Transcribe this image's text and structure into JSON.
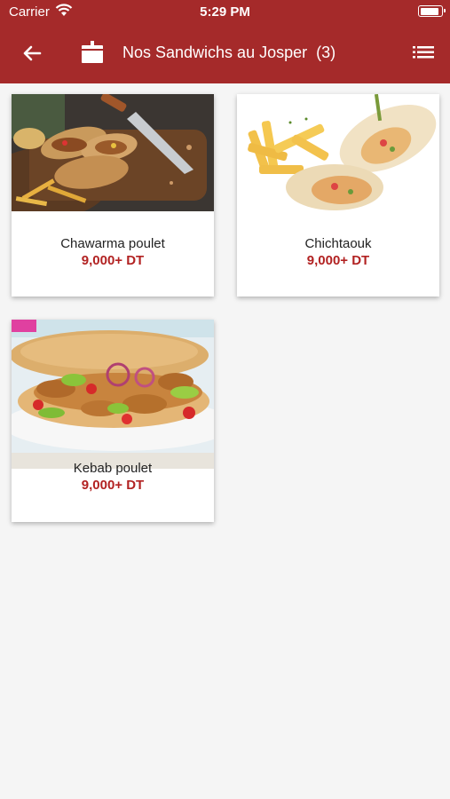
{
  "status": {
    "carrier": "Carrier",
    "time": "5:29 PM",
    "battery_level": 0.95
  },
  "header": {
    "title": "Nos Sandwichs au Josper",
    "count": "(3)"
  },
  "icons": {
    "back": "arrow-left-icon",
    "category": "box-icon",
    "menu": "list-menu-icon"
  },
  "colors": {
    "brand": "#a52a2a",
    "price": "#b22222",
    "background": "#f5f5f5"
  },
  "products": [
    {
      "name": "Chawarma poulet",
      "price": "9,000+ DT"
    },
    {
      "name": "Chichtaouk",
      "price": "9,000+ DT"
    },
    {
      "name": "Kebab poulet",
      "price": "9,000+ DT"
    }
  ]
}
